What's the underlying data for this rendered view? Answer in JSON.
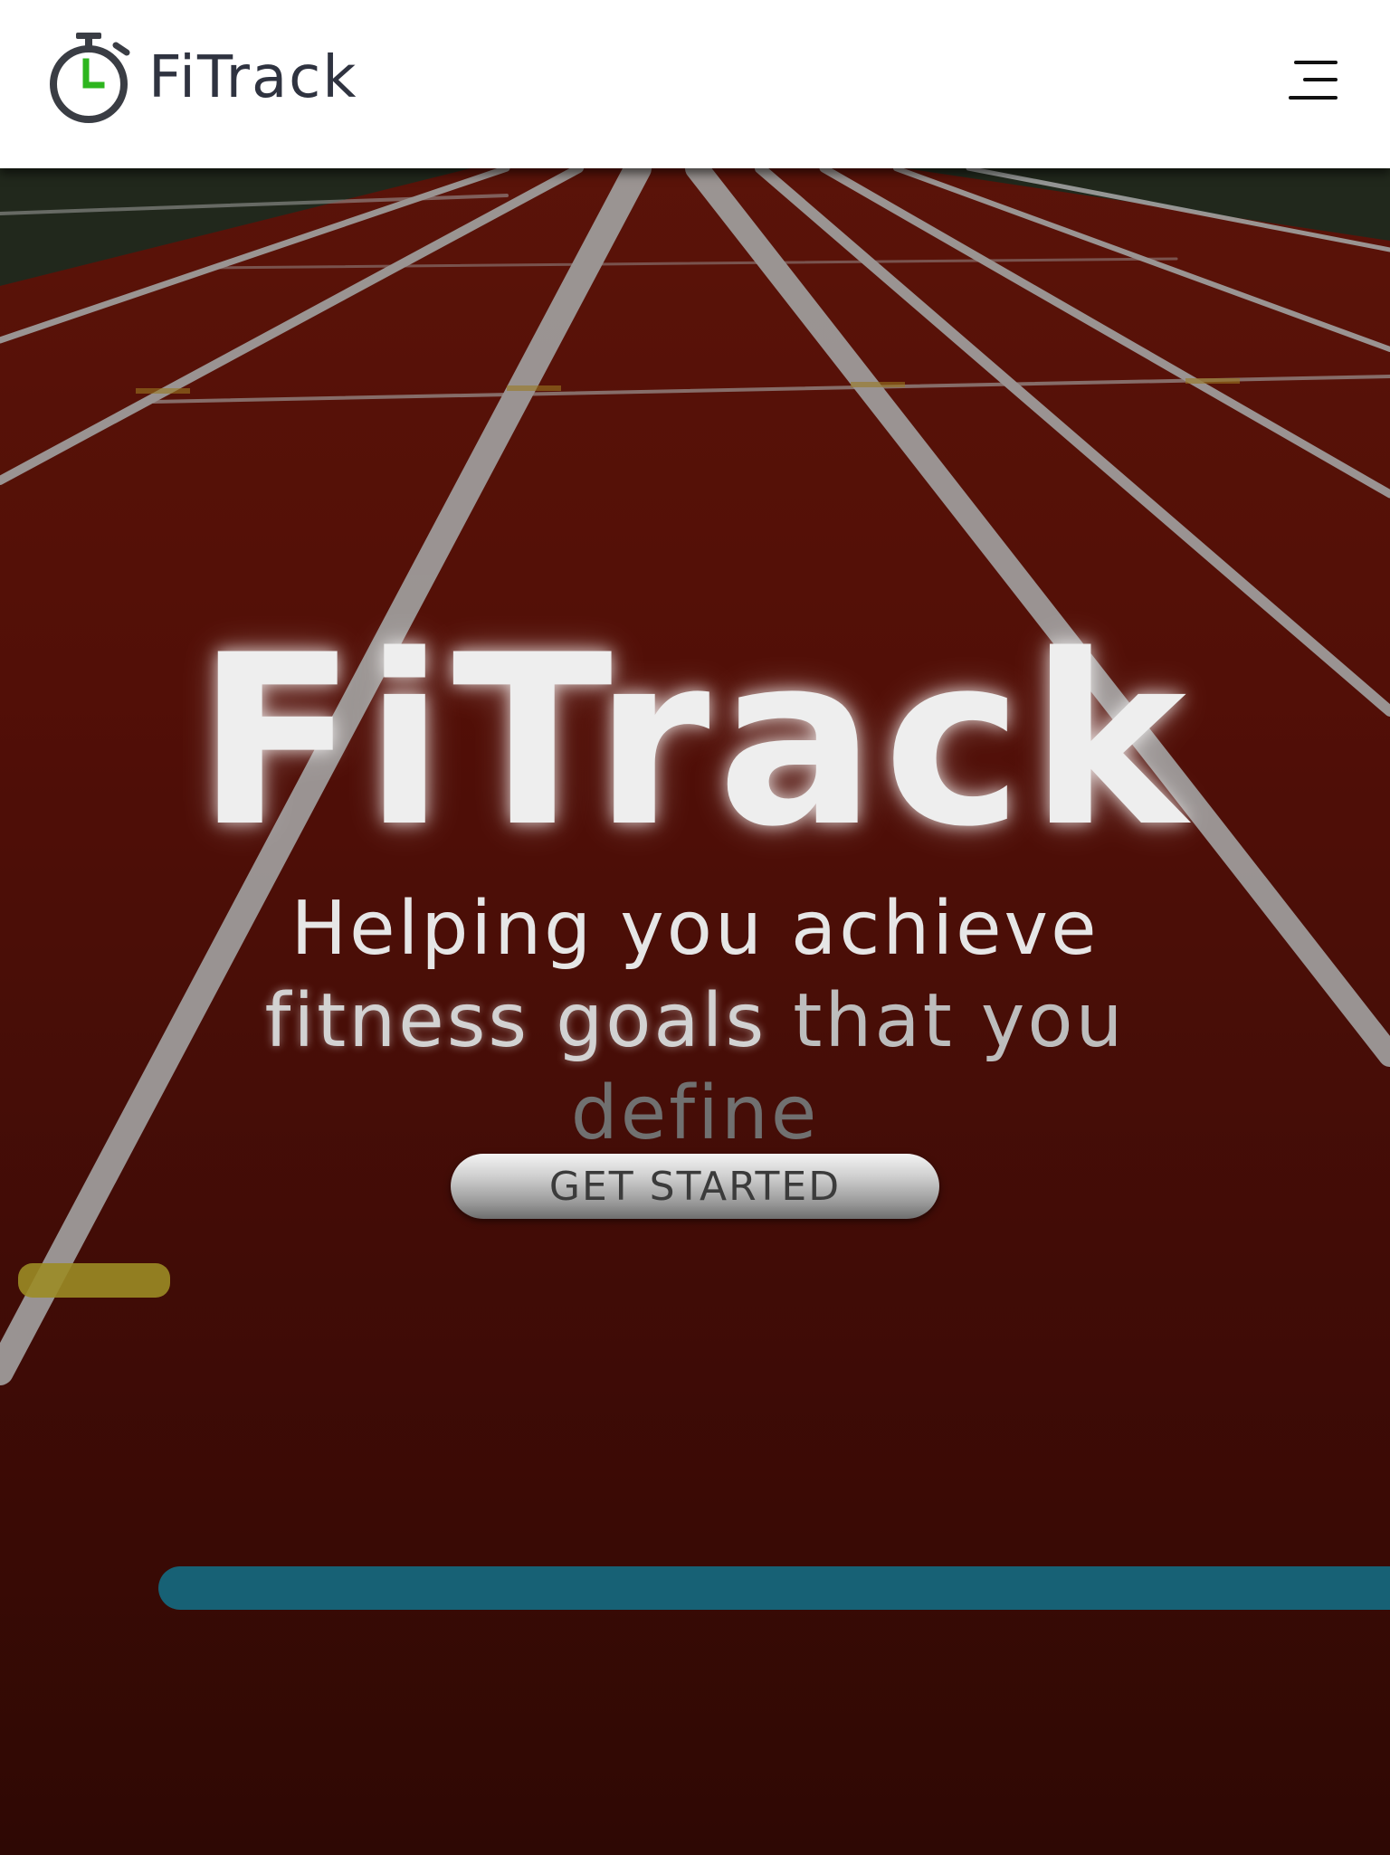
{
  "navbar": {
    "brand": "FiTrack",
    "logo_icon": "stopwatch-icon",
    "menu_icon": "hamburger-menu-icon"
  },
  "hero": {
    "title": "FiTrack",
    "tagline_part1": "Helping you achieve",
    "tagline_part2": "fitness goals",
    "tagline_part3": "that you",
    "tagline_part4": "define",
    "cta_label": "GET STARTED",
    "background": "running-track-photo"
  },
  "colors": {
    "brand_text": "#2f3340",
    "logo_accent": "#2db51e",
    "track_red": "#6a1409",
    "lane_line": "#d0d0d0"
  }
}
